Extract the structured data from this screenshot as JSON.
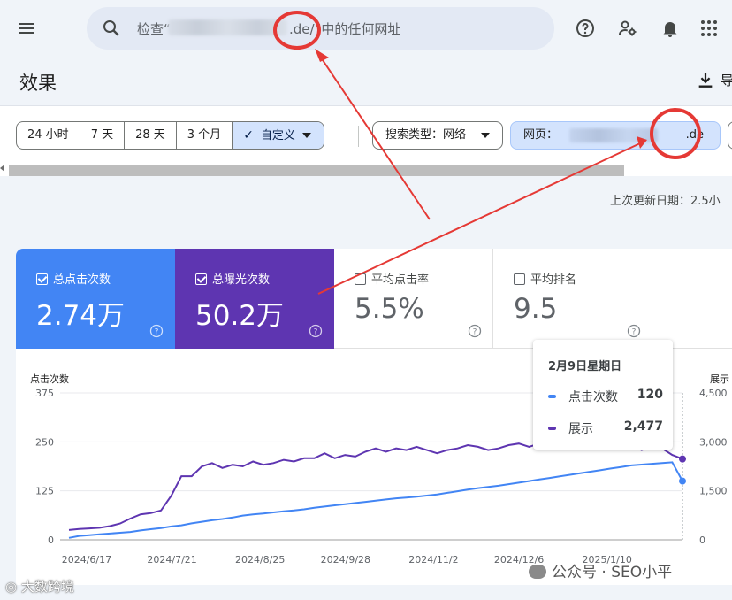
{
  "search": {
    "placeholder_prefix": "检查“",
    "placeholder_suffix": ".de/”中的任何网址"
  },
  "page": {
    "title": "效果",
    "export_label": "导"
  },
  "date_filters": [
    "24 小时",
    "7 天",
    "28 天",
    "3 个月",
    "自定义"
  ],
  "filters": {
    "search_type": "搜索类型：网络",
    "page_prefix": "网页：",
    "page_tld": ".de"
  },
  "last_updated": "上次更新日期：2.5小",
  "metrics": [
    {
      "label": "总点击次数",
      "value": "2.74万",
      "checked": true,
      "color": "#4285f4"
    },
    {
      "label": "总曝光次数",
      "value": "50.2万",
      "checked": true,
      "color": "#5e35b1"
    },
    {
      "label": "平均点击率",
      "value": "5.5%",
      "checked": false
    },
    {
      "label": "平均排名",
      "value": "9.5",
      "checked": false
    }
  ],
  "chart": {
    "left_axis_title": "点击次数",
    "right_axis_title": "展示",
    "left_ticks": [
      "375",
      "250",
      "125",
      "0"
    ],
    "right_ticks": [
      "4,500",
      "3,000",
      "1,500",
      "0"
    ],
    "x_ticks": [
      "2024/6/17",
      "2024/7/21",
      "2024/8/25",
      "2024/9/28",
      "2024/11/2",
      "2024/12/6",
      "2025/1/10"
    ]
  },
  "tooltip": {
    "date": "2月9日星期日",
    "rows": [
      {
        "label": "点击次数",
        "value": "120",
        "color": "#4285f4"
      },
      {
        "label": "展示",
        "value": "2,477",
        "color": "#5e35b1"
      }
    ]
  },
  "chart_data": {
    "type": "line",
    "x_range": [
      "2024/6/10",
      "2025/2/9"
    ],
    "x_ticks": [
      "2024/6/17",
      "2024/7/21",
      "2024/8/25",
      "2024/9/28",
      "2024/11/2",
      "2024/12/6",
      "2025/1/10"
    ],
    "ylim_left": [
      0,
      375
    ],
    "ylim_right": [
      0,
      4500
    ],
    "series": [
      {
        "name": "点击次数",
        "axis": "left",
        "color": "#4285f4",
        "values": [
          5,
          10,
          12,
          14,
          16,
          18,
          20,
          24,
          27,
          30,
          34,
          37,
          42,
          46,
          50,
          53,
          57,
          62,
          65,
          67,
          70,
          73,
          75,
          78,
          82,
          85,
          88,
          91,
          94,
          97,
          100,
          103,
          106,
          108,
          110,
          113,
          116,
          120,
          124,
          128,
          132,
          135,
          138,
          142,
          146,
          150,
          154,
          158,
          162,
          166,
          170,
          174,
          178,
          182,
          186,
          190,
          192,
          194,
          196,
          198,
          150
        ]
      },
      {
        "name": "展示",
        "axis": "right",
        "color": "#5e35b1",
        "values": [
          300,
          330,
          350,
          370,
          420,
          500,
          650,
          780,
          820,
          900,
          1350,
          1950,
          1950,
          2250,
          2350,
          2200,
          2300,
          2250,
          2400,
          2300,
          2350,
          2450,
          2400,
          2500,
          2500,
          2650,
          2500,
          2600,
          2550,
          2700,
          2800,
          2700,
          2800,
          2750,
          2850,
          2750,
          2650,
          2750,
          2800,
          2900,
          2850,
          2750,
          2800,
          2900,
          2950,
          2850,
          2950,
          2850,
          2950,
          2900,
          3000,
          3050,
          2900,
          3000,
          3100,
          2900,
          2750,
          2850,
          2800,
          2600,
          2477
        ]
      }
    ]
  },
  "watermarks": {
    "left": "大数跨境",
    "right": "公众号 · SEO小平"
  },
  "colors": {
    "accent": "#1a73e8",
    "annotation_red": "#e53935"
  }
}
